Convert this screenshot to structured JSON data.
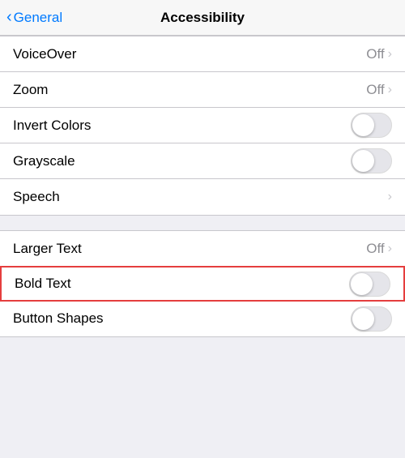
{
  "header": {
    "back_label": "General",
    "title": "Accessibility"
  },
  "sections": [
    {
      "id": "section1",
      "rows": [
        {
          "id": "voiceover",
          "label": "VoiceOver",
          "type": "disclosure",
          "value": "Off"
        },
        {
          "id": "zoom",
          "label": "Zoom",
          "type": "disclosure",
          "value": "Off"
        },
        {
          "id": "invert-colors",
          "label": "Invert Colors",
          "type": "toggle",
          "on": false
        },
        {
          "id": "grayscale",
          "label": "Grayscale",
          "type": "toggle",
          "on": false
        },
        {
          "id": "speech",
          "label": "Speech",
          "type": "disclosure",
          "value": ""
        }
      ]
    },
    {
      "id": "section2",
      "rows": [
        {
          "id": "larger-text",
          "label": "Larger Text",
          "type": "disclosure",
          "value": "Off"
        },
        {
          "id": "bold-text",
          "label": "Bold Text",
          "type": "toggle",
          "on": false,
          "highlighted": true
        },
        {
          "id": "button-shapes",
          "label": "Button Shapes",
          "type": "toggle",
          "on": false
        }
      ]
    }
  ]
}
